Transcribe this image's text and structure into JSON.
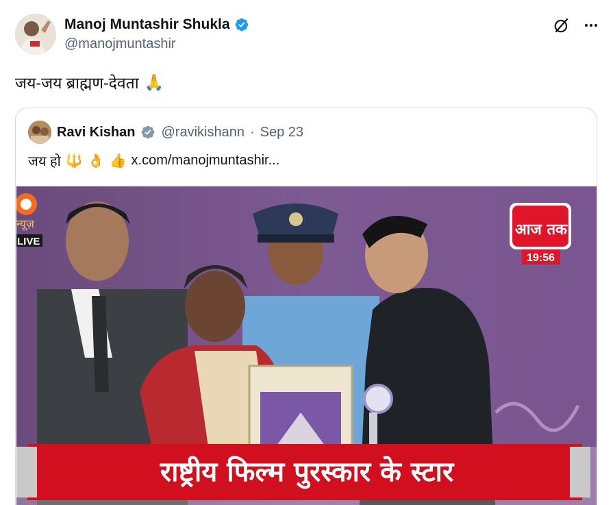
{
  "post": {
    "author_name": "Manoj Muntashir Shukla",
    "author_handle": "@manojmuntashir",
    "text": "जय-जय ब्राह्मण-देवता",
    "text_emoji": "🙏"
  },
  "quoted_post": {
    "author_name": "Ravi Kishan",
    "author_handle": "@ravikishann",
    "separator": "·",
    "date": "Sep 23",
    "text": "जय हो",
    "emojis": [
      "🔱",
      "👌",
      "👍"
    ],
    "link": "x.com/manojmuntashir..."
  },
  "media": {
    "channel_logo_left": "न्यूज़",
    "live_label": "LIVE",
    "channel_logo_right": "आज तक",
    "time": "19:56",
    "banner": "राष्ट्रीय फिल्म पुरस्कार के स्टार"
  },
  "icons": {
    "verified": "verified-badge-icon",
    "grok": "grok-icon",
    "more": "more-icon"
  },
  "colors": {
    "verified_blue": "#1d9bf0",
    "verified_gray": "#829aab",
    "banner_red": "#d10f1f",
    "aajtak_red": "#e0152a"
  }
}
